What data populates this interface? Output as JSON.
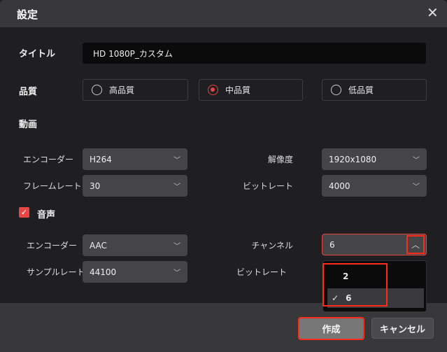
{
  "dialog": {
    "title": "設定",
    "close_icon": "close-icon"
  },
  "title_row": {
    "label": "タイトル",
    "value": "HD 1080P_カスタム"
  },
  "quality": {
    "label": "品質",
    "options": [
      "高品質",
      "中品質",
      "低品質"
    ],
    "selected": "中品質"
  },
  "video": {
    "label": "動画",
    "encoder_label": "エンコーダー",
    "encoder": "H264",
    "resolution_label": "解像度",
    "resolution": "1920x1080",
    "framerate_label": "フレームレート",
    "framerate": "30",
    "bitrate_label": "ビットレート",
    "bitrate": "4000"
  },
  "audio": {
    "label": "音声",
    "checked": true,
    "encoder_label": "エンコーダー",
    "encoder": "AAC",
    "channel_label": "チャンネル",
    "channel": "6",
    "samplerate_label": "サンプルレート",
    "samplerate": "44100",
    "bitrate_label": "ビットレート",
    "channel_options": [
      "2",
      "6"
    ]
  },
  "buttons": {
    "create": "作成",
    "cancel": "キャンセル"
  },
  "colors": {
    "accent": "#e84545",
    "highlight": "#ff2a1a"
  }
}
